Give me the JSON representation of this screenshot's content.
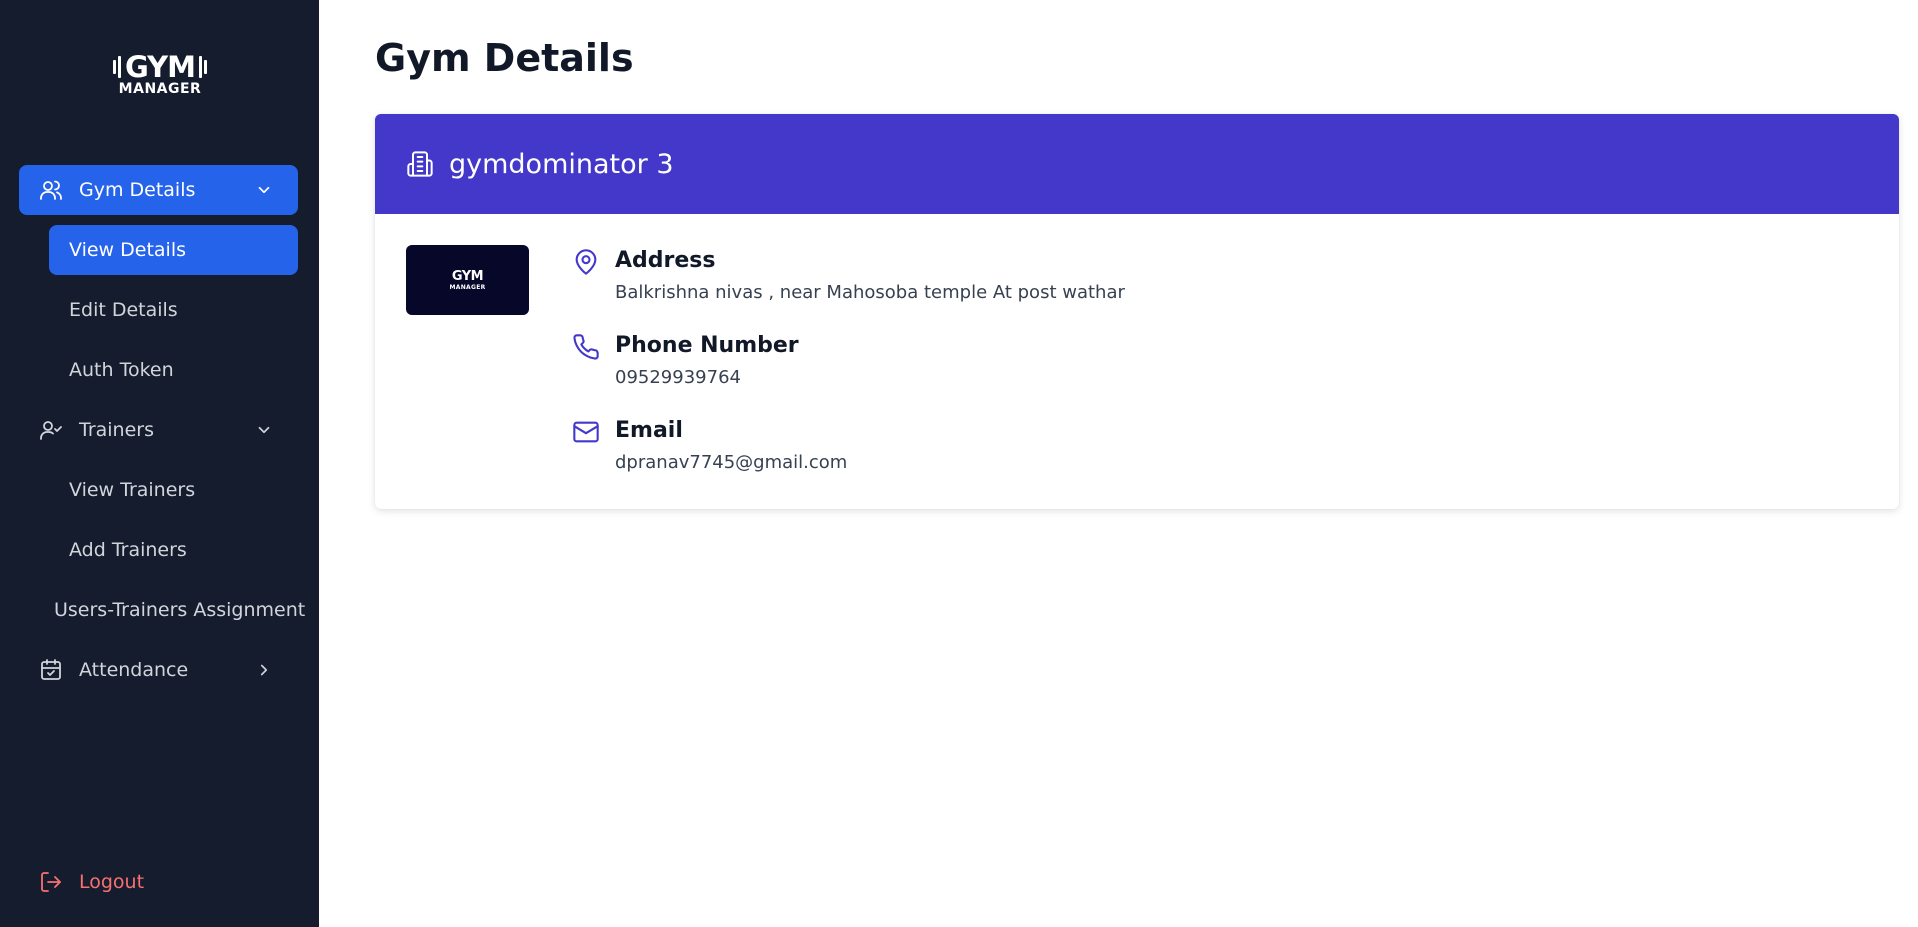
{
  "logo": {
    "word": "GYM",
    "sub": "MANAGER"
  },
  "sidebar": {
    "gym_details": {
      "label": "Gym Details",
      "icon": "users-icon"
    },
    "view_details": "View Details",
    "edit_details": "Edit Details",
    "auth_token": "Auth Token",
    "trainers": {
      "label": "Trainers",
      "icon": "user-check-icon"
    },
    "view_trainers": "View Trainers",
    "add_trainers": "Add Trainers",
    "assignment": "Users-Trainers Assignment",
    "attendance": {
      "label": "Attendance",
      "icon": "calendar-check-icon"
    },
    "logout": "Logout"
  },
  "main": {
    "title": "Gym Details",
    "card": {
      "gym_name": "gymdominator 3",
      "thumb": {
        "word": "GYM",
        "sub": "MANAGER"
      },
      "address": {
        "label": "Address",
        "value": "Balkrishna nivas , near Mahosoba temple At post wathar"
      },
      "phone": {
        "label": "Phone Number",
        "value": "09529939764"
      },
      "email": {
        "label": "Email",
        "value": "dpranav7745@gmail.com"
      }
    }
  },
  "colors": {
    "sidebar_bg": "#141c2e",
    "accent": "#2563eb",
    "header": "#4338ca",
    "logout": "#f87171"
  }
}
